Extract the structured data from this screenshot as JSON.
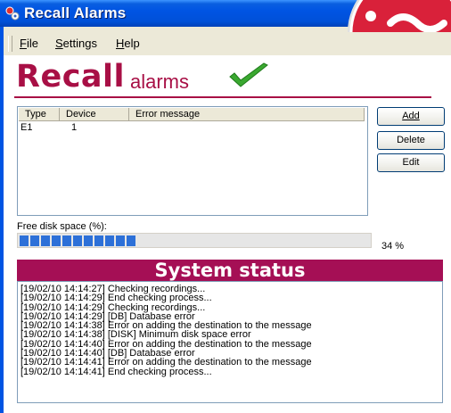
{
  "window": {
    "title": "Recall Alarms"
  },
  "menu": [
    {
      "label": "File",
      "mnemonic": "F"
    },
    {
      "label": "Settings",
      "mnemonic": "S"
    },
    {
      "label": "Help",
      "mnemonic": "H"
    }
  ],
  "logo": {
    "main": "Recall",
    "sub": "alarms"
  },
  "alarms_table": {
    "columns": [
      "Type",
      "Device",
      "Error message"
    ],
    "rows": [
      {
        "type": "E1",
        "device": "1",
        "message": ""
      }
    ]
  },
  "buttons": {
    "add": "Add",
    "delete": "Delete",
    "edit": "Edit"
  },
  "disk": {
    "label": "Free disk space (%):",
    "value_text": "34 %",
    "percent": 34
  },
  "status": {
    "title": "System status",
    "log": [
      "[19/02/10 14:14:27] Checking recordings...",
      "[19/02/10 14:14:29] End checking process...",
      "[19/02/10 14:14:29] Checking recordings...",
      "[19/02/10 14:14:29] [DB] Database error",
      "[19/02/10 14:14:38] Error on adding the destination to the message",
      "[19/02/10 14:14:38] [DISK] Minimum disk space error",
      "[19/02/10 14:14:40] Error on adding the destination to the message",
      "[19/02/10 14:14:40] [DB] Database error",
      "[19/02/10 14:14:41] Error on adding the destination to the message",
      "[19/02/10 14:14:41] End checking process..."
    ]
  },
  "colors": {
    "brand": "#a80f45",
    "titlebar": "#0054e3",
    "progress": "#2d70d8"
  },
  "icons": [
    "app-icon",
    "checkmark-icon",
    "red-badge-icon"
  ]
}
